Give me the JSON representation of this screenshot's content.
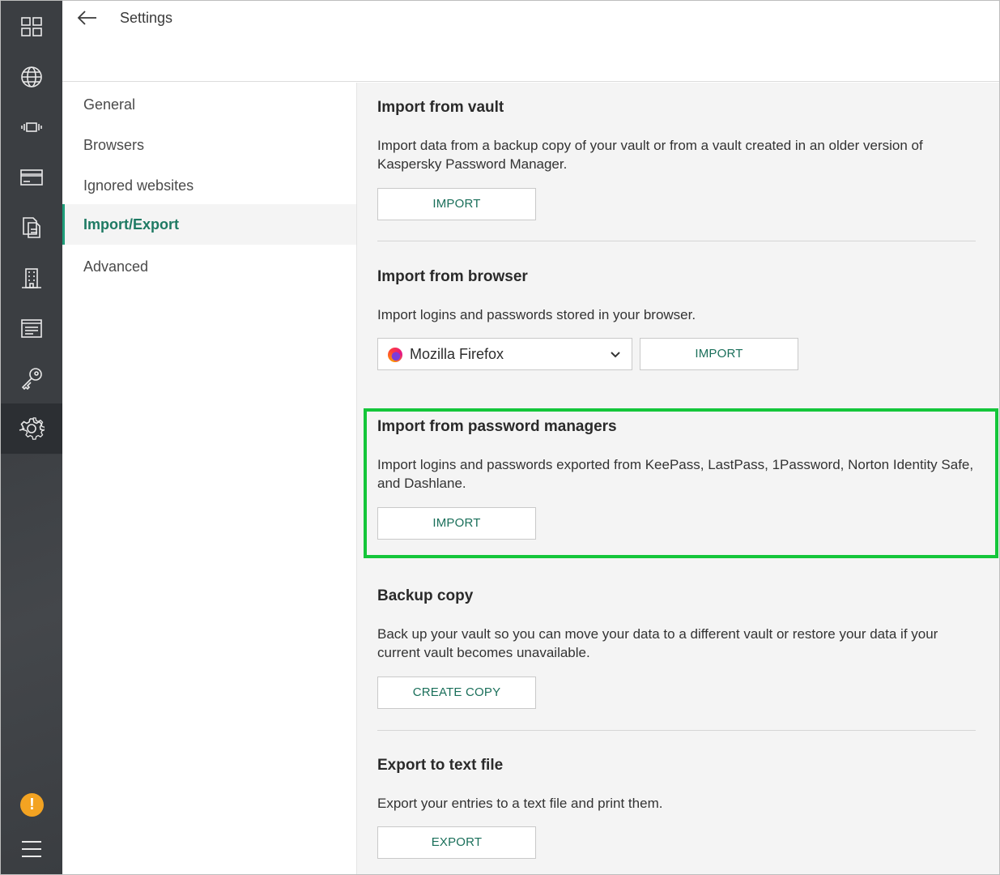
{
  "header": {
    "title": "Settings"
  },
  "rail": {
    "icons": [
      "dashboard-icon",
      "globe-icon",
      "ticket-icon",
      "card-icon",
      "documents-icon",
      "building-icon",
      "notes-icon",
      "key-icon",
      "settings-icon"
    ],
    "active": "settings-icon",
    "warning_glyph": "!"
  },
  "nav": {
    "items": [
      {
        "label": "General"
      },
      {
        "label": "Browsers"
      },
      {
        "label": "Ignored websites"
      },
      {
        "label": "Import/Export",
        "active": true
      },
      {
        "label": "Advanced"
      }
    ]
  },
  "sections": {
    "vault": {
      "title": "Import from vault",
      "description": "Import data from a backup copy of your vault or from a vault created in an older version of Kaspersky Password Manager.",
      "button": "IMPORT"
    },
    "browser": {
      "title": "Import from browser",
      "description": "Import logins and passwords stored in your browser.",
      "selected_browser": "Mozilla Firefox",
      "button": "IMPORT"
    },
    "managers": {
      "title": "Import from password managers",
      "description": "Import logins and passwords exported from KeePass, LastPass, 1Password, Norton Identity Safe, and Dashlane.",
      "button": "IMPORT"
    },
    "backup": {
      "title": "Backup copy",
      "description": "Back up your vault so you can move your data to a different vault or restore your data if your current vault becomes unavailable.",
      "button": "CREATE COPY"
    },
    "export": {
      "title": "Export to text file",
      "description": "Export your entries to a text file and print them.",
      "button": "EXPORT"
    }
  },
  "colors": {
    "rail_bg": "#3b3e42",
    "accent": "#1e7a63",
    "highlight": "#14c63a",
    "warning": "#f3a322"
  }
}
